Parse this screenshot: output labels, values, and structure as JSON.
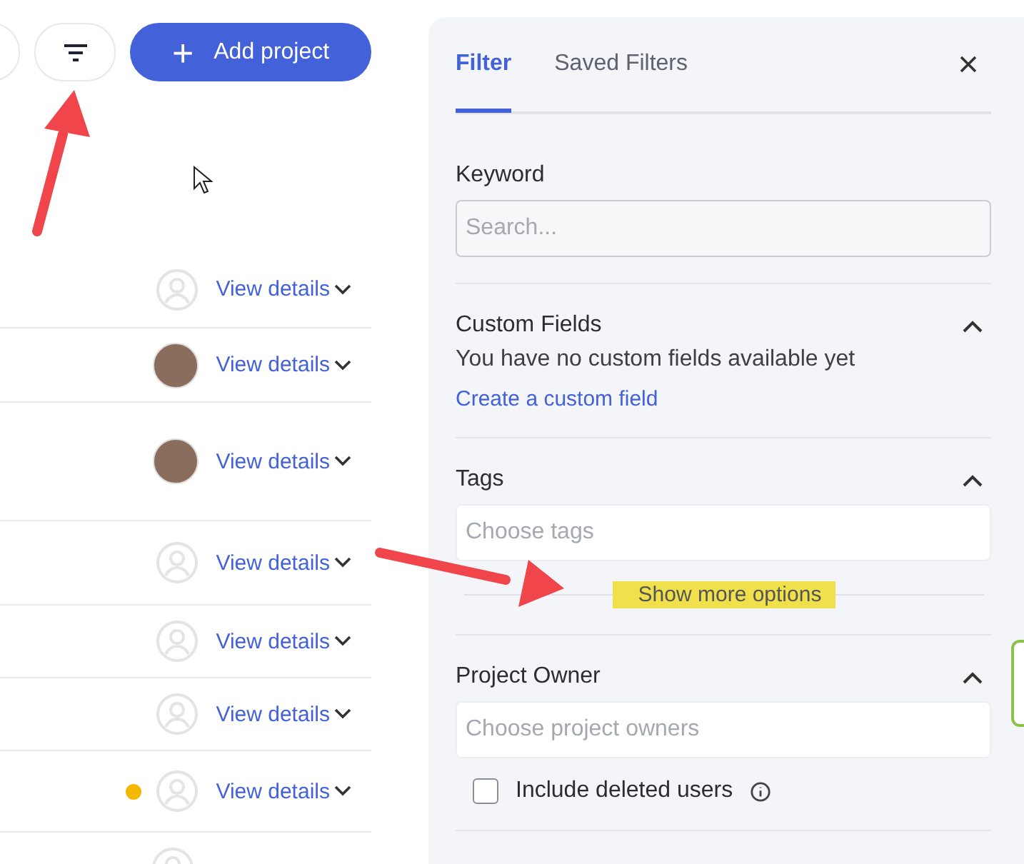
{
  "toolbar": {
    "add_button": {
      "label": "Add project",
      "icon": "+"
    }
  },
  "rows": [
    {
      "kind": "placeholder",
      "link": "View details"
    },
    {
      "kind": "photo",
      "link": "View details"
    },
    {
      "kind": "photo",
      "link": "View details"
    },
    {
      "kind": "placeholder",
      "link": "View details"
    },
    {
      "kind": "placeholder",
      "link": "View details"
    },
    {
      "kind": "placeholder",
      "link": "View details"
    },
    {
      "kind": "placeholder",
      "link": "View details",
      "color": "#f5b800"
    },
    {
      "kind": "placeholder"
    }
  ],
  "filter_panel": {
    "tabs": [
      {
        "label": "Filter",
        "selected": true
      },
      {
        "label": "Saved Filters",
        "selected": false
      }
    ],
    "keyword": {
      "label": "Keyword",
      "placeholder": "Search..."
    },
    "custom_fields": {
      "title": "Custom Fields",
      "expanded": true,
      "message": "You have no custom fields available yet",
      "link": "Create a custom field"
    },
    "tags": {
      "title": "Tags",
      "expanded": true,
      "placeholder": "Choose tags",
      "more": "Show more options"
    },
    "project_owner": {
      "title": "Project Owner",
      "expanded": true,
      "placeholder": "Choose project owners",
      "checkbox": {
        "label": "Include deleted users",
        "checked": false
      }
    }
  }
}
